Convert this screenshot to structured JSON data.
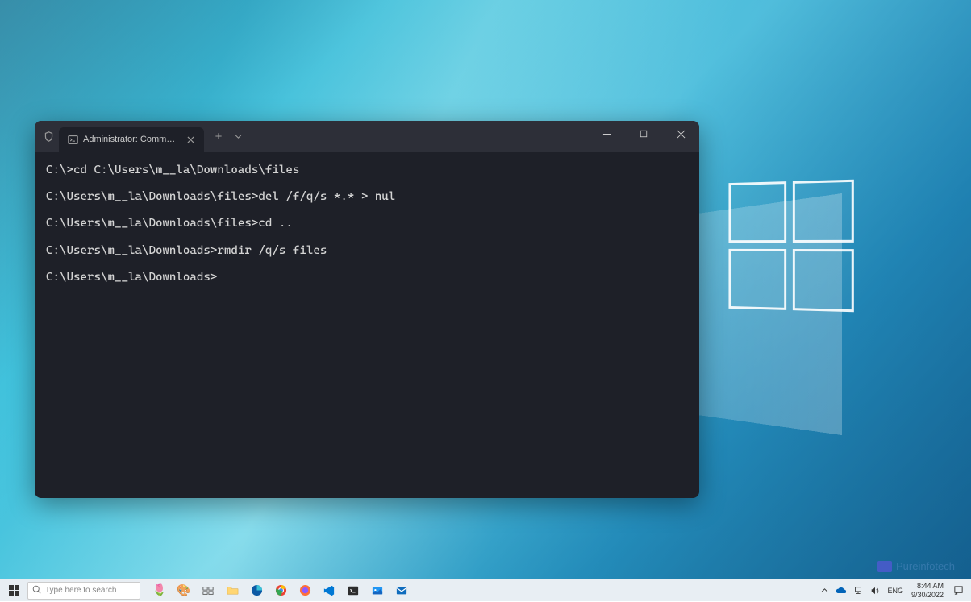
{
  "terminal": {
    "tab_title": "Administrator: Command Pror",
    "lines": [
      "C:\\>cd C:\\Users\\m__la\\Downloads\\files",
      "C:\\Users\\m__la\\Downloads\\files>del /f/q/s *.* > nul",
      "C:\\Users\\m__la\\Downloads\\files>cd ..",
      "C:\\Users\\m__la\\Downloads>rmdir /q/s files",
      "C:\\Users\\m__la\\Downloads>"
    ]
  },
  "taskbar": {
    "search_placeholder": "Type here to search",
    "language": "ENG",
    "time": "8:44 AM",
    "date": "9/30/2022"
  },
  "watermark": {
    "text": "Pureinfotech"
  },
  "icons": {
    "shield": "shield-icon",
    "cmd": "cmd-icon",
    "close": "close-icon",
    "plus": "plus-icon",
    "chevron_down": "chevron-down-icon",
    "minimize": "minimize-icon",
    "maximize": "maximize-icon",
    "close_window": "close-window-icon",
    "search": "search-icon",
    "chevron_up": "chevron-up-icon",
    "cloud": "cloud-icon",
    "network": "network-icon",
    "volume": "volume-icon",
    "notification": "notification-icon"
  }
}
